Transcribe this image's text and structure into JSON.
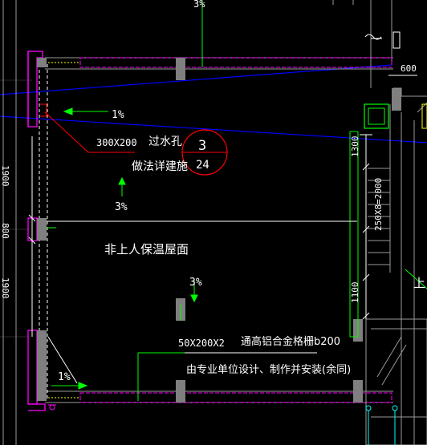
{
  "drawing": {
    "colors": {
      "background": "#000000",
      "wall": "#ff00ff",
      "beam": "#00ff00",
      "slope_line": "#0000ff",
      "column": "#7f7f7f",
      "marker": "#ff0000",
      "roof_note": "#ff7f27",
      "text": "#ffffff"
    },
    "labels": {
      "slope_top": "3%",
      "slope_left_upper": "1%",
      "hole_size": "300X200",
      "hole_name": "过水孔",
      "method_note": "做法详建施",
      "detail_number": "3",
      "detail_sheet": "24",
      "slope_mid": "3%",
      "roof_name": "非上人保温屋面",
      "slope_lower": "3%",
      "grille_size": "50X200X2",
      "grille_name": "通高铝合金格栅b200",
      "grille_note": "由专业单位设计、制作并安装(余同)",
      "slope_left_lower": "1%",
      "dim_600": "600",
      "dim_1300": "1300",
      "dim_stair": "250X8=2000",
      "dim_1100": "1100",
      "dim_left_1900_top": "1900",
      "dim_left_800": "800",
      "dim_left_1900_bottom": "1900",
      "stair_text": "上"
    },
    "icons": [
      "slope-arrow-icon",
      "detail-callout-icon",
      "ladder-icon"
    ]
  }
}
